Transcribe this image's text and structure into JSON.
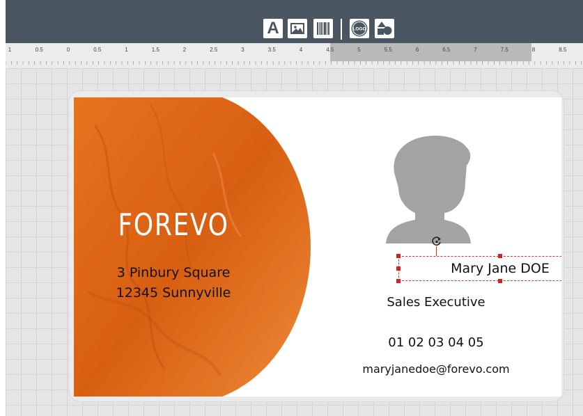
{
  "toolbar": {
    "buttons": [
      {
        "name": "text-tool-button",
        "icon": "text-icon",
        "glyph": "A"
      },
      {
        "name": "image-tool-button",
        "icon": "image-icon"
      },
      {
        "name": "barcode-tool-button",
        "icon": "barcode-icon"
      },
      {
        "name": "logo-tool-button",
        "icon": "logo-icon",
        "glyph": "LOGO"
      },
      {
        "name": "shapes-tool-button",
        "icon": "shapes-icon"
      }
    ]
  },
  "ruler": {
    "labels": [
      "1",
      "0.5",
      "0",
      "0.5",
      "1",
      "1.5",
      "2",
      "2.5",
      "3",
      "3.5",
      "4",
      "4.5",
      "5",
      "5.5",
      "6",
      "6.5",
      "7",
      "7.5",
      "8",
      "8.5"
    ]
  },
  "card": {
    "brand": "FOREVO",
    "address_line1": "3 Pinbury Square",
    "address_line2": "12345 Sunnyville",
    "name": "Mary Jane DOE",
    "title": "Sales Executive",
    "phone": "01 02 03 04 05",
    "email": "maryjanedoe@forevo.com",
    "colors": {
      "accent": "#e8731e",
      "accent_dark": "#c0540d",
      "band": "#5a5c5f",
      "photo_placeholder": "#a3a3a3",
      "selection": "#e03030"
    }
  }
}
